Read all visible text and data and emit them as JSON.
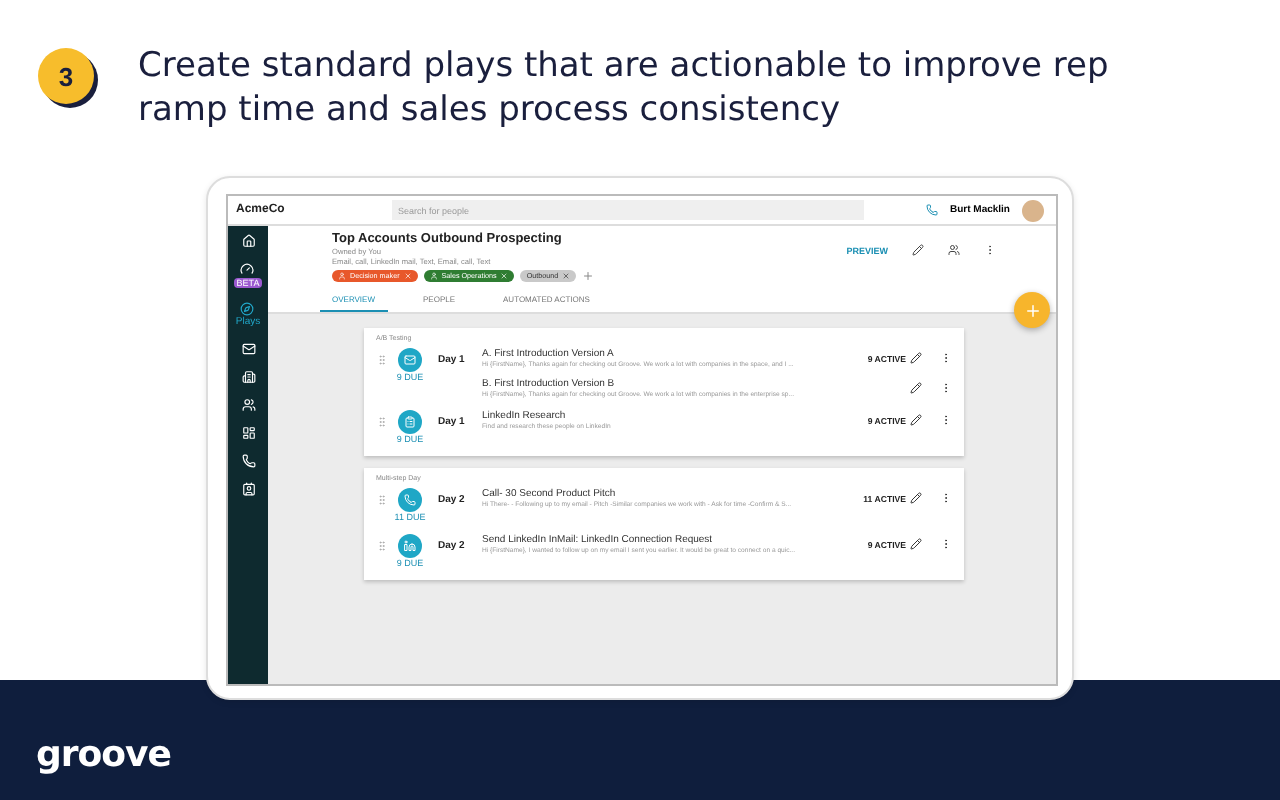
{
  "step": {
    "number": "3",
    "heading": "Create standard plays that are actionable to improve rep ramp time and sales process consistency"
  },
  "app": {
    "company": "AcmeCo",
    "search": {
      "placeholder": "Search for people"
    },
    "user": {
      "name": "Burt Macklin"
    },
    "nav": [
      {
        "kind": "home",
        "selected": false
      },
      {
        "kind": "gauge",
        "badge": "BETA",
        "selected": false
      },
      {
        "kind": "compass",
        "label": "Plays",
        "selected": true
      },
      {
        "kind": "mail",
        "selected": false
      },
      {
        "kind": "building",
        "selected": false
      },
      {
        "kind": "people",
        "selected": false
      },
      {
        "kind": "dashboard",
        "selected": false
      },
      {
        "kind": "phone",
        "selected": false
      },
      {
        "kind": "contact",
        "selected": false
      }
    ],
    "play": {
      "title": "Top Accounts Outbound Prospecting",
      "owner": "Owned by You",
      "steps": "Email, call, LinkedIn mail, Text, Email, call, Text",
      "preview": "PREVIEW",
      "tags": [
        {
          "label": "Decision maker",
          "kind": "person",
          "color": "#e8582b"
        },
        {
          "label": "Sales Operations",
          "kind": "person",
          "color": "#2f7d32"
        },
        {
          "label": "Outbound",
          "kind": "plain",
          "color": "#c9c9c9"
        }
      ],
      "tabs": [
        {
          "label": "OVERVIEW",
          "selected": true
        },
        {
          "label": "PEOPLE",
          "selected": false
        },
        {
          "label": "AUTOMATED ACTIONS",
          "selected": false
        }
      ]
    },
    "groups": [
      {
        "label": "A/B Testing",
        "steps": [
          {
            "day": "Day 1",
            "kind": "mail",
            "due": "9 DUE",
            "variants": [
              {
                "title": "A. First Introduction Version A",
                "preview": "Hi {FirstName}, Thanks again for checking out Groove. We work a lot with companies in the  space, and I ...",
                "active": "9 ACTIVE"
              },
              {
                "title": "B. First Introduction Version B",
                "preview": "Hi {FirstName}, Thanks again for checking out Groove. We work a lot with companies in the enterprise sp..."
              }
            ]
          },
          {
            "day": "Day 1",
            "kind": "task",
            "due": "9 DUE",
            "variants": [
              {
                "title": "LinkedIn Research",
                "preview": "Find and research these people on LinkedIn",
                "active": "9 ACTIVE"
              }
            ]
          }
        ]
      },
      {
        "label": "Multi-step Day",
        "steps": [
          {
            "day": "Day 2",
            "kind": "phone",
            "due": "11 DUE",
            "variants": [
              {
                "title": "Call- 30 Second Product Pitch",
                "preview": "Hi There- - Following up to my email - Pitch -Similar companies we work with - Ask for time -Confirm & S...",
                "active": "11 ACTIVE"
              }
            ]
          },
          {
            "day": "Day 2",
            "kind": "linkedin",
            "due": "9 DUE",
            "variants": [
              {
                "title": "Send LinkedIn InMail: LinkedIn Connection Request",
                "preview": "Hi {FirstName}, I wanted to follow up on my email I sent you earlier. It would be great to connect on a quic...",
                "active": "9 ACTIVE"
              }
            ]
          }
        ]
      }
    ]
  },
  "brand": {
    "logo": "groove"
  }
}
